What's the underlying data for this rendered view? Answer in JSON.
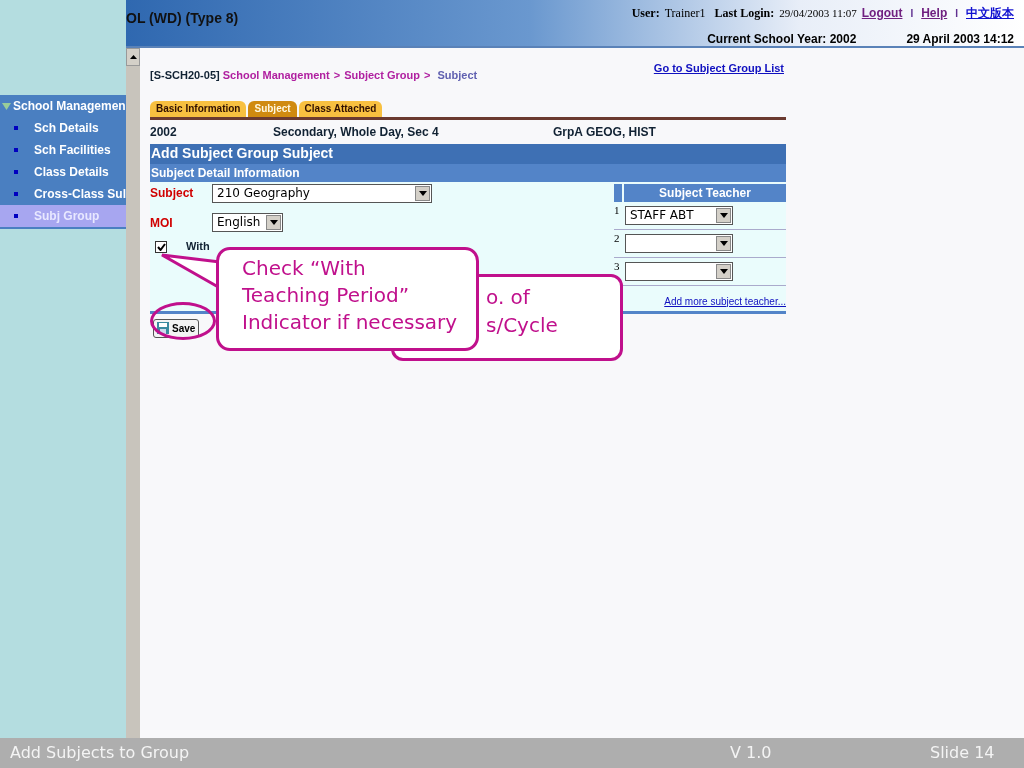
{
  "header": {
    "title": "OL (WD) (Type 8)",
    "user_label": "User:",
    "user": "Trainer1",
    "last_login_label": "Last Login:",
    "last_login": "29/04/2003 11:07",
    "links": [
      "Logout",
      "Help",
      "中文版本"
    ],
    "separators": [
      "I",
      "I"
    ],
    "school_year": "Current School Year: 2002",
    "datetime": "29 April 2003 14:12"
  },
  "sidebar": {
    "title": "School Managemen",
    "expanded": true,
    "items": [
      {
        "label": "Sch Details",
        "selected": false
      },
      {
        "label": "Sch Facilities",
        "selected": false
      },
      {
        "label": "Class Details",
        "selected": false
      },
      {
        "label": "Cross-Class Sul",
        "selected": false
      },
      {
        "label": "Subj Group",
        "selected": true
      }
    ]
  },
  "breadcrumb": {
    "code": "[S-SCH20-05]",
    "path": [
      "School Management",
      "Subject Group"
    ],
    "separators": [
      ">",
      ">"
    ],
    "current": "Subject",
    "link": "Go to Subject Group List"
  },
  "tabs": [
    {
      "label": "Basic Information",
      "selected": false
    },
    {
      "label": "Subject",
      "selected": true
    },
    {
      "label": "Class Attached",
      "selected": false
    }
  ],
  "info": [
    "2002",
    "Secondary, Whole Day, Sec 4",
    "GrpA GEOG, HIST"
  ],
  "form": {
    "title": "Add Subject Group Subject",
    "section": "Subject Detail Information",
    "subject": {
      "label": "Subject",
      "value": "210 Geography"
    },
    "moi": {
      "label": "MOI",
      "value": "English"
    },
    "indicator": {
      "label": "With",
      "checked": true
    },
    "save_button": "Save"
  },
  "teachers": {
    "heading": "Subject Teacher",
    "rows": [
      {
        "number": "1",
        "value": "STAFF ABT"
      },
      {
        "number": "2"
      },
      {
        "number": "3"
      }
    ],
    "add_link": "Add more subject teacher..."
  },
  "callouts": [
    {
      "lines": [
        "Check “With",
        "Teaching Period”",
        "Indicator if necessary"
      ]
    },
    {
      "lines": [
        "o. of",
        "s/Cycle"
      ]
    }
  ],
  "footer": {
    "title": "Add Subjects to Group",
    "version": "V 1.0",
    "slide": "Slide 14"
  }
}
